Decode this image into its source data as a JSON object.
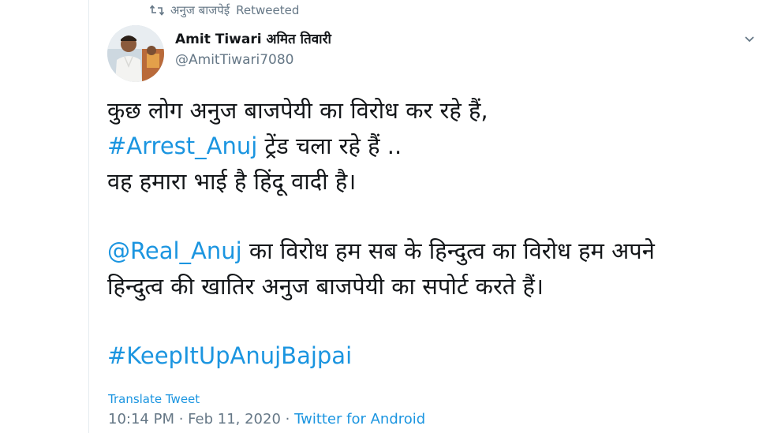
{
  "retweet": {
    "icon": "retweet-icon",
    "by": "अनुज बाजपेई",
    "label": "Retweeted"
  },
  "author": {
    "avatar_icon": "avatar",
    "name": "Amit Tiwari अमित तिवारी",
    "handle": "@AmitTiwari7080"
  },
  "menu": {
    "icon": "chevron-down-icon"
  },
  "tweet": {
    "line1": "कुछ लोग अनुज बाजपेयी का विरोध कर रहे हैं,",
    "line2_hashtag": "#Arrest_Anuj",
    "line2_rest": " ट्रेंड चला रहे हैं ..",
    "line3": "वह हमारा भाई है हिंदू वादी है।",
    "line4_mention": "@Real_Anuj",
    "line4_rest": " का विरोध हम सब के हिन्दुत्व का विरोध हम अपने",
    "line5": "हिन्दुत्व की खातिर अनुज बाजपेयी का सपोर्ट करते हैं।",
    "hashtag": "#KeepItUpAnujBajpai"
  },
  "translate_label": "Translate Tweet",
  "meta": {
    "time": "10:14 PM",
    "separator": " · ",
    "date": "Feb 11, 2020",
    "source": "Twitter for Android"
  },
  "colors": {
    "link": "#1b95e0",
    "muted": "#657786",
    "text": "#14171a"
  }
}
